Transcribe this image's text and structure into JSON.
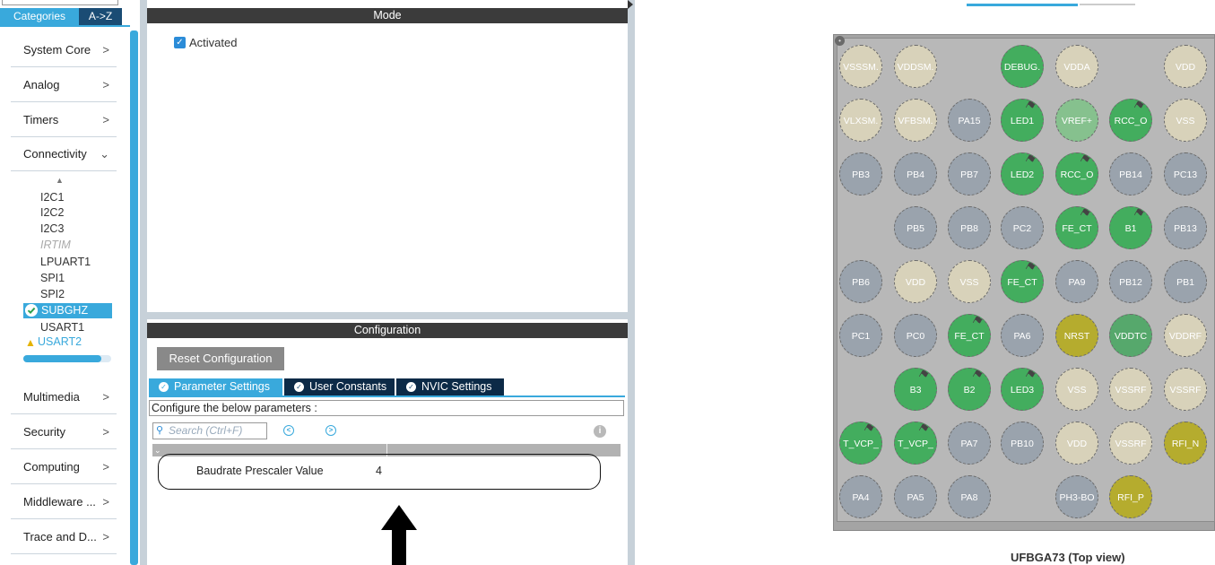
{
  "sidebar": {
    "tab_categories": "Categories",
    "tab_az": "A->Z",
    "categories": [
      {
        "label": "System Core",
        "chevron": ">"
      },
      {
        "label": "Analog",
        "chevron": ">"
      },
      {
        "label": "Timers",
        "chevron": ">"
      },
      {
        "label": "Connectivity",
        "chevron": "v"
      },
      {
        "label": "Multimedia",
        "chevron": ">"
      },
      {
        "label": "Security",
        "chevron": ">"
      },
      {
        "label": "Computing",
        "chevron": ">"
      },
      {
        "label": "Middleware ...",
        "chevron": ">"
      },
      {
        "label": "Trace and D...",
        "chevron": ">"
      }
    ],
    "connectivity_items": [
      "I2C1",
      "I2C2",
      "I2C3",
      "IRTIM",
      "LPUART1",
      "SPI1",
      "SPI2"
    ],
    "selected_item": "SUBGHZ",
    "usart1": "USART1",
    "usart2": "USART2"
  },
  "mode": {
    "header": "Mode",
    "activated_label": "Activated"
  },
  "configuration": {
    "header": "Configuration",
    "reset_button": "Reset Configuration",
    "tabs": [
      "Parameter Settings",
      "User Constants",
      "NVIC Settings"
    ],
    "note": "Configure the below parameters :",
    "search_placeholder": "Search (Ctrl+F)",
    "parameters": [
      {
        "name": "Baudrate Prescaler Value",
        "value": "4"
      }
    ]
  },
  "pinout": {
    "package_label": "UFBGA73 (Top view)",
    "pins": [
      {
        "label": "VSSSM.",
        "state": "power"
      },
      {
        "label": "VDDSM.",
        "state": "power"
      },
      {
        "label": "DEBUG.",
        "state": "assigned"
      },
      {
        "label": "VDDA",
        "state": "power"
      },
      {
        "label": "VDD",
        "state": "power"
      },
      {
        "label": "VLXSM.",
        "state": "power"
      },
      {
        "label": "VFBSM.",
        "state": "power"
      },
      {
        "label": "PA15",
        "state": "free"
      },
      {
        "label": "LED1",
        "state": "pinned"
      },
      {
        "label": "VREF+",
        "state": "light"
      },
      {
        "label": "RCC_O",
        "state": "pinned"
      },
      {
        "label": "VSS",
        "state": "power"
      },
      {
        "label": "PB3",
        "state": "free"
      },
      {
        "label": "PB4",
        "state": "free"
      },
      {
        "label": "PB7",
        "state": "free"
      },
      {
        "label": "LED2",
        "state": "pinned"
      },
      {
        "label": "RCC_O",
        "state": "pinned"
      },
      {
        "label": "PB14",
        "state": "free"
      },
      {
        "label": "PC13",
        "state": "free"
      },
      {
        "label": "PB5",
        "state": "free"
      },
      {
        "label": "PB8",
        "state": "free"
      },
      {
        "label": "PC2",
        "state": "free"
      },
      {
        "label": "FE_CT",
        "state": "pinned"
      },
      {
        "label": "B1",
        "state": "pinned"
      },
      {
        "label": "PB13",
        "state": "free"
      },
      {
        "label": "PB6",
        "state": "free"
      },
      {
        "label": "VDD",
        "state": "power"
      },
      {
        "label": "VSS",
        "state": "power"
      },
      {
        "label": "FE_CT",
        "state": "pinned"
      },
      {
        "label": "PA9",
        "state": "free"
      },
      {
        "label": "PB12",
        "state": "free"
      },
      {
        "label": "PB1",
        "state": "free"
      },
      {
        "label": "PC1",
        "state": "free"
      },
      {
        "label": "PC0",
        "state": "free"
      },
      {
        "label": "FE_CT",
        "state": "pinned"
      },
      {
        "label": "PA6",
        "state": "free"
      },
      {
        "label": "NRST",
        "state": "reset"
      },
      {
        "label": "VDDTC",
        "state": "special"
      },
      {
        "label": "VDDRF",
        "state": "power"
      },
      {
        "label": "B3",
        "state": "pinned"
      },
      {
        "label": "B2",
        "state": "pinned"
      },
      {
        "label": "LED3",
        "state": "pinned"
      },
      {
        "label": "VSS",
        "state": "power"
      },
      {
        "label": "VSSRF",
        "state": "power"
      },
      {
        "label": "VSSRF",
        "state": "power"
      },
      {
        "label": "T_VCP_",
        "state": "pinned"
      },
      {
        "label": "T_VCP_",
        "state": "pinned"
      },
      {
        "label": "PA7",
        "state": "free"
      },
      {
        "label": "PB10",
        "state": "free"
      },
      {
        "label": "VDD",
        "state": "power"
      },
      {
        "label": "VSSRF",
        "state": "power"
      },
      {
        "label": "RFI_N",
        "state": "reset"
      },
      {
        "label": "PA4",
        "state": "free"
      },
      {
        "label": "PA5",
        "state": "free"
      },
      {
        "label": "PA8",
        "state": "free"
      },
      {
        "label": "PH3-BO",
        "state": "free"
      },
      {
        "label": "RFI_P",
        "state": "reset"
      }
    ]
  },
  "colors": {
    "accent": "#39a9dc",
    "dark_tab": "#0c2a47",
    "pin_assigned": "#43ad5e",
    "pin_power": "#d8d2ba",
    "pin_free": "#9aa3ad",
    "pin_reset": "#b5ac2e"
  }
}
